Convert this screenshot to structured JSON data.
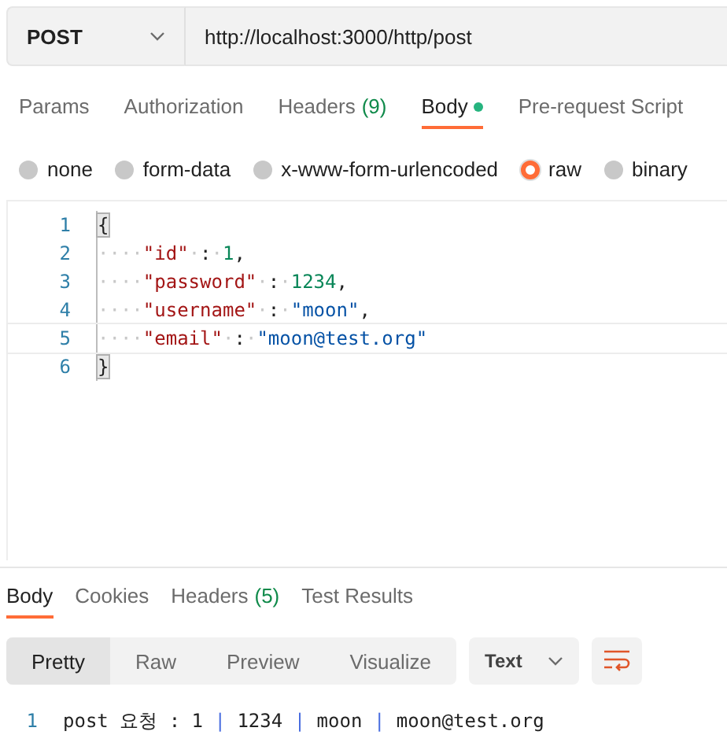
{
  "request": {
    "method": "POST",
    "url": "http://localhost:3000/http/post"
  },
  "request_tabs": [
    {
      "label": "Params",
      "selected": false,
      "dot": false
    },
    {
      "label": "Authorization",
      "selected": false,
      "dot": false
    },
    {
      "label": "Headers",
      "count": "(9)",
      "selected": false,
      "dot": false
    },
    {
      "label": "Body",
      "selected": true,
      "dot": true
    },
    {
      "label": "Pre-request Script",
      "selected": false,
      "dot": false
    }
  ],
  "body_types": [
    {
      "label": "none",
      "selected": false
    },
    {
      "label": "form-data",
      "selected": false
    },
    {
      "label": "x-www-form-urlencoded",
      "selected": false
    },
    {
      "label": "raw",
      "selected": true
    },
    {
      "label": "binary",
      "selected": false
    }
  ],
  "editor": {
    "lines": [
      {
        "number": "1",
        "active": false,
        "tokens": [
          {
            "kind": "bracket",
            "text": "{"
          }
        ]
      },
      {
        "number": "2",
        "active": false,
        "tokens": [
          {
            "kind": "ws",
            "text": "····"
          },
          {
            "kind": "key",
            "text": "\"id\""
          },
          {
            "kind": "ws",
            "text": "·"
          },
          {
            "kind": "punct",
            "text": ":"
          },
          {
            "kind": "ws",
            "text": "·"
          },
          {
            "kind": "number",
            "text": "1"
          },
          {
            "kind": "punct",
            "text": ","
          }
        ]
      },
      {
        "number": "3",
        "active": false,
        "tokens": [
          {
            "kind": "ws",
            "text": "····"
          },
          {
            "kind": "key",
            "text": "\"password\""
          },
          {
            "kind": "ws",
            "text": "·"
          },
          {
            "kind": "punct",
            "text": ":"
          },
          {
            "kind": "ws",
            "text": "·"
          },
          {
            "kind": "number",
            "text": "1234"
          },
          {
            "kind": "punct",
            "text": ","
          }
        ]
      },
      {
        "number": "4",
        "active": false,
        "tokens": [
          {
            "kind": "ws",
            "text": "····"
          },
          {
            "kind": "key",
            "text": "\"username\""
          },
          {
            "kind": "ws",
            "text": "·"
          },
          {
            "kind": "punct",
            "text": ":"
          },
          {
            "kind": "ws",
            "text": "·"
          },
          {
            "kind": "string",
            "text": "\"moon\""
          },
          {
            "kind": "punct",
            "text": ","
          }
        ]
      },
      {
        "number": "5",
        "active": true,
        "tokens": [
          {
            "kind": "ws",
            "text": "····"
          },
          {
            "kind": "key",
            "text": "\"email\""
          },
          {
            "kind": "ws",
            "text": "·"
          },
          {
            "kind": "punct",
            "text": ":"
          },
          {
            "kind": "ws",
            "text": "·"
          },
          {
            "kind": "string",
            "text": "\"moon@test.org\""
          }
        ]
      },
      {
        "number": "6",
        "active": false,
        "tokens": [
          {
            "kind": "bracket",
            "text": "}"
          }
        ]
      }
    ]
  },
  "response_tabs": [
    {
      "label": "Body",
      "selected": true
    },
    {
      "label": "Cookies",
      "selected": false
    },
    {
      "label": "Headers",
      "count": "(5)",
      "selected": false
    },
    {
      "label": "Test Results",
      "selected": false
    }
  ],
  "view_modes": [
    {
      "label": "Pretty",
      "selected": true
    },
    {
      "label": "Raw",
      "selected": false
    },
    {
      "label": "Preview",
      "selected": false
    },
    {
      "label": "Visualize",
      "selected": false
    }
  ],
  "format": "Text",
  "response_lines": [
    {
      "number": "1",
      "tokens": [
        {
          "kind": "text",
          "text": "post 요청 : 1 "
        },
        {
          "kind": "pipe",
          "text": "|"
        },
        {
          "kind": "text",
          "text": " 1234 "
        },
        {
          "kind": "pipe",
          "text": "|"
        },
        {
          "kind": "text",
          "text": " moon "
        },
        {
          "kind": "pipe",
          "text": "|"
        },
        {
          "kind": "text",
          "text": " moon@test.org"
        }
      ]
    }
  ]
}
